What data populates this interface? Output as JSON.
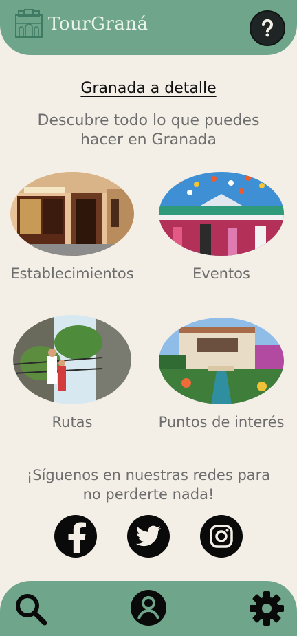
{
  "header": {
    "brand": "TourGraná",
    "logo_icon": "alhambra-logo-icon",
    "help_icon": "question-icon"
  },
  "main": {
    "title": "Granada a detalle",
    "subtitle": "Descubre todo lo que puedes hacer en Granada",
    "categories": [
      {
        "label": "Establecimientos",
        "icon": "storefront-photo"
      },
      {
        "label": "Eventos",
        "icon": "fair-photo"
      },
      {
        "label": "Rutas",
        "icon": "hiking-bridge-photo"
      },
      {
        "label": "Puntos de interés",
        "icon": "generalife-garden-photo"
      }
    ],
    "follow_text": "¡Síguenos en nuestras redes para no perderte nada!",
    "social": [
      {
        "name": "facebook",
        "icon": "facebook-icon"
      },
      {
        "name": "twitter",
        "icon": "twitter-icon"
      },
      {
        "name": "instagram",
        "icon": "instagram-icon"
      }
    ]
  },
  "footer": {
    "items": [
      {
        "name": "search",
        "icon": "search-icon"
      },
      {
        "name": "profile",
        "icon": "user-icon"
      },
      {
        "name": "settings",
        "icon": "gear-icon"
      }
    ]
  },
  "colors": {
    "primary": "#6fa58a",
    "background": "#f3efe6",
    "text_muted": "#6d6d6d",
    "icon_dark": "#0a0a0a"
  }
}
